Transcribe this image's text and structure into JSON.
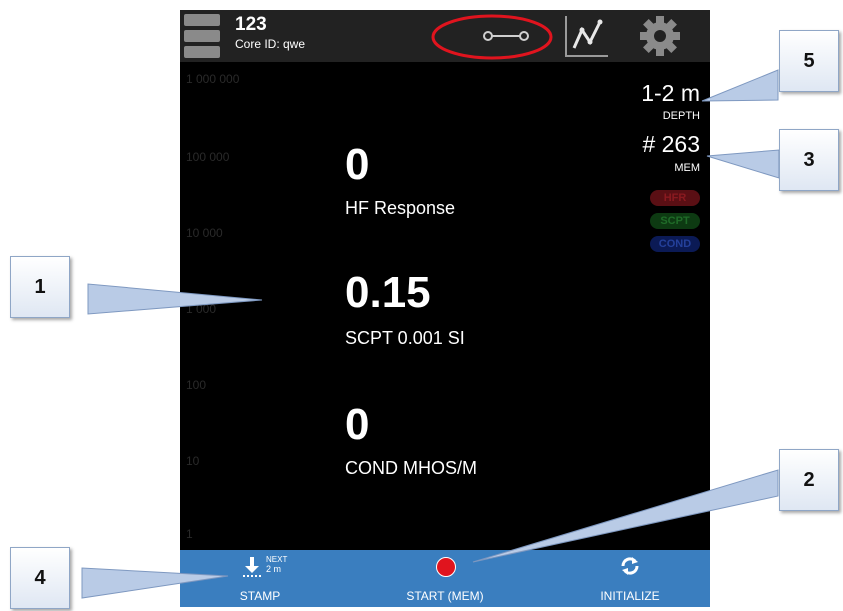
{
  "header": {
    "title": "123",
    "core_id": "Core ID: qwe",
    "bluetooth_icon": "connection-icon",
    "chart_icon": "chart-icon",
    "settings_icon": "gear-icon",
    "highlight_color": "#e0141e"
  },
  "axis_ticks": [
    "1 000 000",
    "100 000",
    "10 000",
    "1 000",
    "100",
    "10",
    "1"
  ],
  "readings": [
    {
      "value": "0",
      "label": "HF Response"
    },
    {
      "value": "0.15",
      "label": "SCPT 0.001 SI"
    },
    {
      "value": "0",
      "label": "COND MHOS/M"
    }
  ],
  "status": {
    "depth_value": "1-2 m",
    "depth_label": "DEPTH",
    "mem_value": "# 263",
    "mem_label": "MEM",
    "badges": [
      {
        "label": "HFR",
        "color": "#5a0f14",
        "text_color": "#8a1a20"
      },
      {
        "label": "SCPT",
        "color": "#0d3a12",
        "text_color": "#1f6b28"
      },
      {
        "label": "COND",
        "color": "#0b1a55",
        "text_color": "#24409a"
      }
    ]
  },
  "bottom_bar": {
    "stamp_label": "STAMP",
    "next_label": "NEXT",
    "next_value": "2 m",
    "start_label": "START (MEM)",
    "initialize_label": "INITIALIZE",
    "bar_color": "#3a7ebf",
    "record_color": "#e0141e"
  },
  "callouts": [
    "1",
    "2",
    "3",
    "4",
    "5"
  ]
}
